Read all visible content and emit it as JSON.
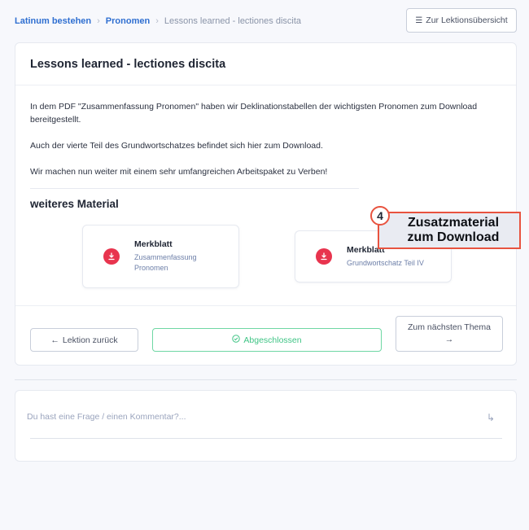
{
  "breadcrumb": {
    "items": [
      "Latinum bestehen",
      "Pronomen"
    ],
    "current": "Lessons learned - lectiones discita",
    "separator": "›"
  },
  "header": {
    "overview_button": "Zur Lektionsübersicht",
    "overview_icon": "list-icon"
  },
  "lesson": {
    "title": "Lessons learned - lectiones discita",
    "paragraphs": [
      "In dem PDF \"Zusammenfassung Pronomen\" haben wir Deklinationstabellen der wichtigsten Pronomen zum Download bereitgestellt.",
      "Auch der vierte Teil des Grundwortschatzes befindet sich hier zum Download.",
      "Wir machen nun weiter mit einem sehr umfangreichen Arbeitspaket zu Verben!"
    ]
  },
  "material": {
    "section_title": "weiteres Material",
    "items": [
      {
        "title": "Merkblatt",
        "subtitle": "Zusammenfassung Pronomen",
        "icon": "download-icon"
      },
      {
        "title": "Merkblatt",
        "subtitle": "Grundwortschatz Teil IV",
        "icon": "download-icon"
      }
    ]
  },
  "callout": {
    "number": "4",
    "text_line1": "Zusatzmaterial",
    "text_line2": "zum Download",
    "color": "#e8533f"
  },
  "footer": {
    "back_label": "Lektion zurück",
    "back_arrow": "←",
    "done_label": "Abgeschlossen",
    "done_icon": "✓",
    "next_label": "Zum nächsten Thema",
    "next_arrow": "→"
  },
  "comment": {
    "placeholder": "Du hast eine Frage / einen Kommentar?...",
    "send_icon": "↳"
  },
  "colors": {
    "accent_blue": "#2f6fd1",
    "download_red": "#e8344e",
    "done_green": "#3fc485"
  }
}
